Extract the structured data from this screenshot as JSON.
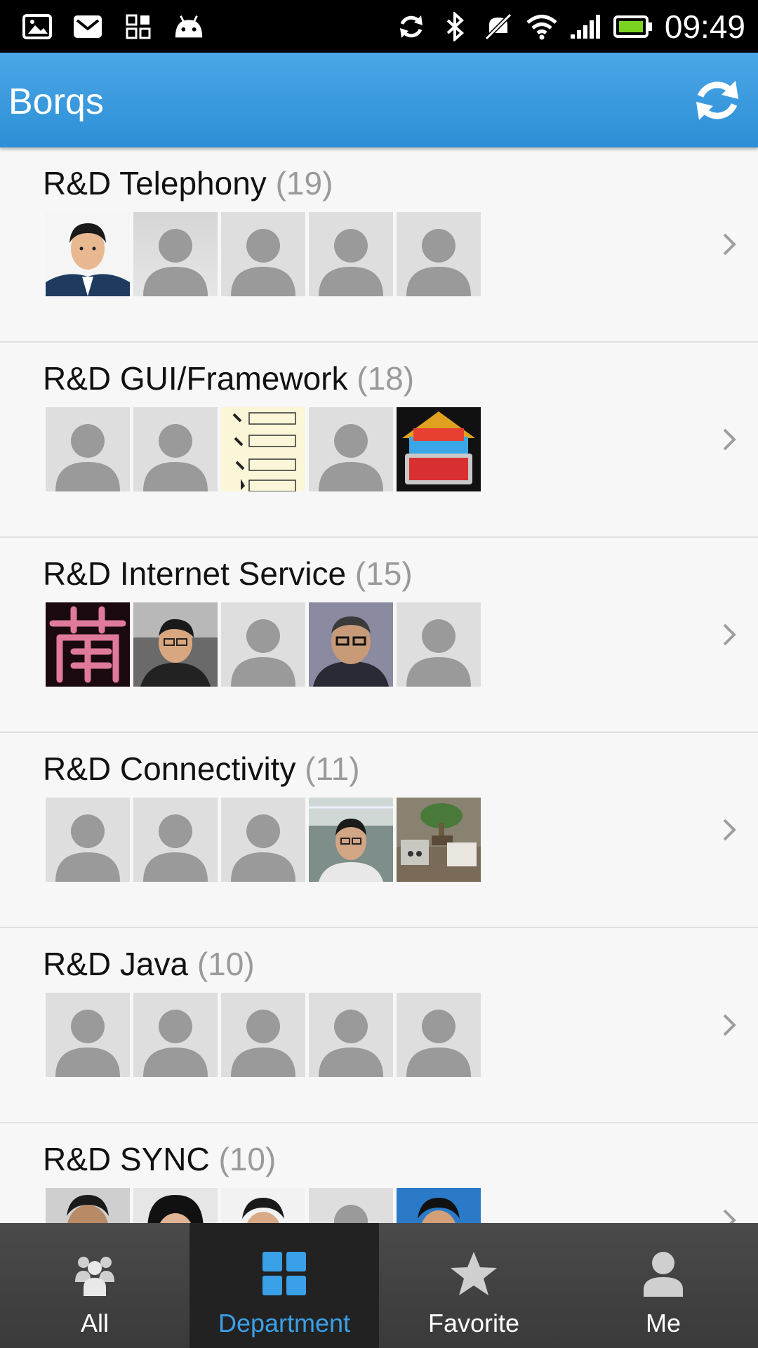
{
  "status_bar": {
    "time": "09:49",
    "left_icons": [
      "image-notification-icon",
      "mail-icon",
      "apps-icon",
      "android-icon"
    ],
    "right_icons": [
      "sync-icon",
      "bluetooth-icon",
      "mute-icon",
      "wifi-icon",
      "signal-icon",
      "battery-icon"
    ]
  },
  "action_bar": {
    "title": "Borqs",
    "refresh_icon": "refresh-icon",
    "accent_color": "#3399dd"
  },
  "departments": [
    {
      "name": "R&D Telephony",
      "count": "(19)",
      "avatars": [
        "photo-man-portrait",
        "default",
        "default",
        "default",
        "default"
      ]
    },
    {
      "name": "R&D GUI/Framework",
      "count": "(18)",
      "avatars": [
        "default",
        "default",
        "photo-notes",
        "default",
        "photo-home-3d"
      ]
    },
    {
      "name": "R&D Internet Service",
      "count": "(15)",
      "avatars": [
        "photo-pink-character",
        "photo-man-glasses",
        "default",
        "photo-man-glasses-dark",
        "default"
      ]
    },
    {
      "name": "R&D Connectivity",
      "count": "(11)",
      "avatars": [
        "default",
        "default",
        "default",
        "photo-man-office",
        "photo-desk-plant"
      ]
    },
    {
      "name": "R&D Java",
      "count": "(10)",
      "avatars": [
        "default",
        "default",
        "default",
        "default",
        "default"
      ]
    },
    {
      "name": "R&D SYNC",
      "count": "(10)",
      "avatars": [
        "photo-man",
        "photo-woman",
        "photo-man-white",
        "default",
        "photo-man-blue"
      ]
    }
  ],
  "bottom_nav": {
    "tabs": [
      {
        "label": "All",
        "icon": "group-icon"
      },
      {
        "label": "Department",
        "icon": "grid-icon",
        "active": true
      },
      {
        "label": "Favorite",
        "icon": "star-icon"
      },
      {
        "label": "Me",
        "icon": "person-icon"
      }
    ],
    "active_color": "#3aa0e8"
  }
}
